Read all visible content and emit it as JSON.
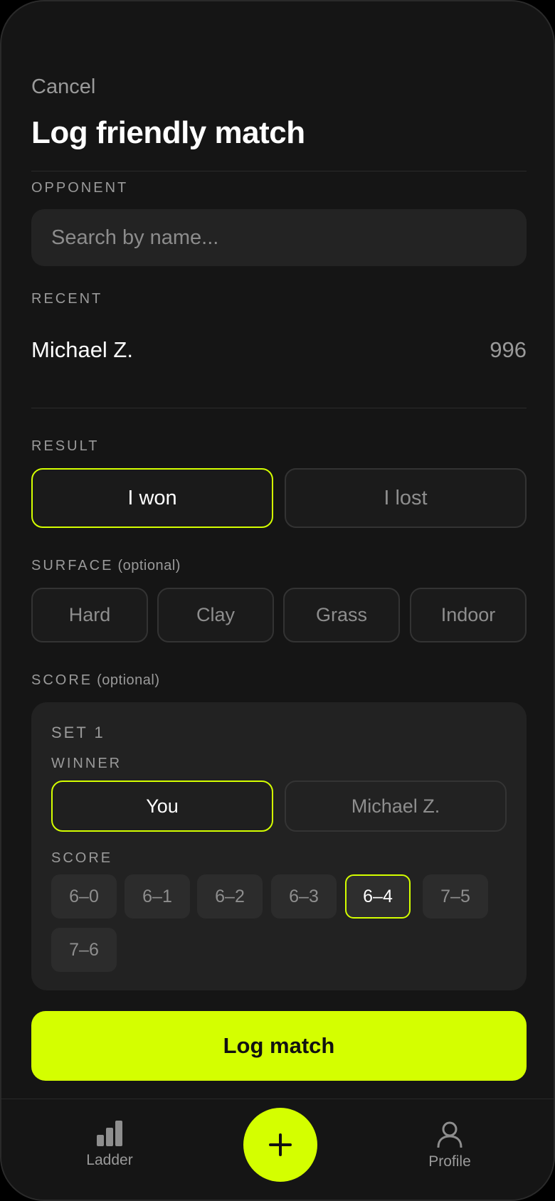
{
  "header": {
    "cancel_label": "Cancel",
    "title": "Log friendly match"
  },
  "opponent": {
    "label": "OPPONENT",
    "search_placeholder": "Search by name...",
    "search_value": ""
  },
  "recent": {
    "label": "RECENT",
    "items": [
      {
        "name": "Michael Z.",
        "rating": "996"
      }
    ]
  },
  "result": {
    "label": "RESULT",
    "options": [
      {
        "label": "I won",
        "selected": true
      },
      {
        "label": "I lost",
        "selected": false
      }
    ]
  },
  "surface": {
    "label": "SURFACE",
    "optional": "(optional)",
    "options": [
      "Hard",
      "Clay",
      "Grass",
      "Indoor"
    ]
  },
  "score": {
    "label": "SCORE",
    "optional": "(optional)",
    "set_title": "SET 1",
    "winner_label": "WINNER",
    "winner_options": [
      {
        "label": "You",
        "selected": true
      },
      {
        "label": "Michael Z.",
        "selected": false
      }
    ],
    "score_label": "SCORE",
    "chips": [
      {
        "label": "6–0",
        "selected": false
      },
      {
        "label": "6–1",
        "selected": false
      },
      {
        "label": "6–2",
        "selected": false
      },
      {
        "label": "6–3",
        "selected": false
      },
      {
        "label": "6–4",
        "selected": true
      },
      {
        "label": "7–5",
        "selected": false
      },
      {
        "label": "7–6",
        "selected": false
      }
    ]
  },
  "submit_label": "Log match",
  "tabbar": {
    "left_label": "Ladder",
    "right_label": "Profile",
    "fab_icon": "plus-icon"
  },
  "colors": {
    "accent": "#d4ff00",
    "background": "#151515",
    "surface": "#232323"
  }
}
